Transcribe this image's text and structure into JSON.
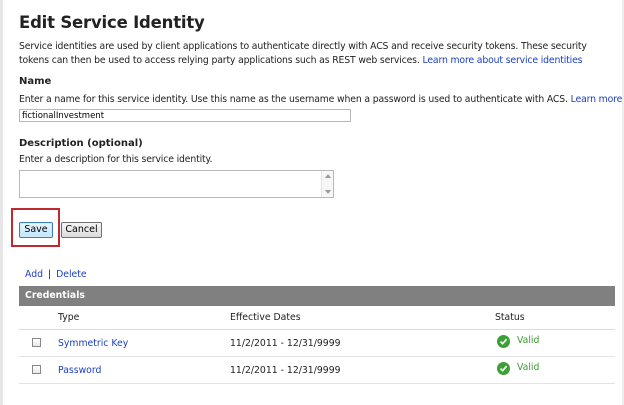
{
  "page": {
    "title": "Edit Service Identity",
    "intro_text": "Service identities are used by client applications to authenticate directly with ACS and receive security tokens. These security tokens can then be used to access relying party applications such as REST web services.",
    "intro_link": "Learn more about service identities"
  },
  "name_section": {
    "label": "Name",
    "hint": "Enter a name for this service identity. Use this name as the username when a password is used to authenticate with ACS.",
    "hint_link": "Learn more",
    "value": "fictionalInvestment"
  },
  "description_section": {
    "label": "Description (optional)",
    "hint": "Enter a description for this service identity.",
    "value": ""
  },
  "buttons": {
    "save": "Save",
    "cancel": "Cancel"
  },
  "actions": {
    "add": "Add",
    "separator": "|",
    "delete": "Delete"
  },
  "credentials": {
    "caption": "Credentials",
    "headers": {
      "type": "Type",
      "dates": "Effective Dates",
      "status": "Status"
    },
    "rows": [
      {
        "type": "Symmetric Key",
        "dates": "11/2/2011 - 12/31/9999",
        "status": "Valid",
        "status_icon": "check-circle-icon"
      },
      {
        "type": "Password",
        "dates": "11/2/2011 - 12/31/9999",
        "status": "Valid",
        "status_icon": "check-circle-icon"
      }
    ]
  },
  "colors": {
    "link": "#1a3ec1",
    "valid": "#3a9a33",
    "highlight": "#c0282d",
    "grid_caption": "#808080"
  }
}
